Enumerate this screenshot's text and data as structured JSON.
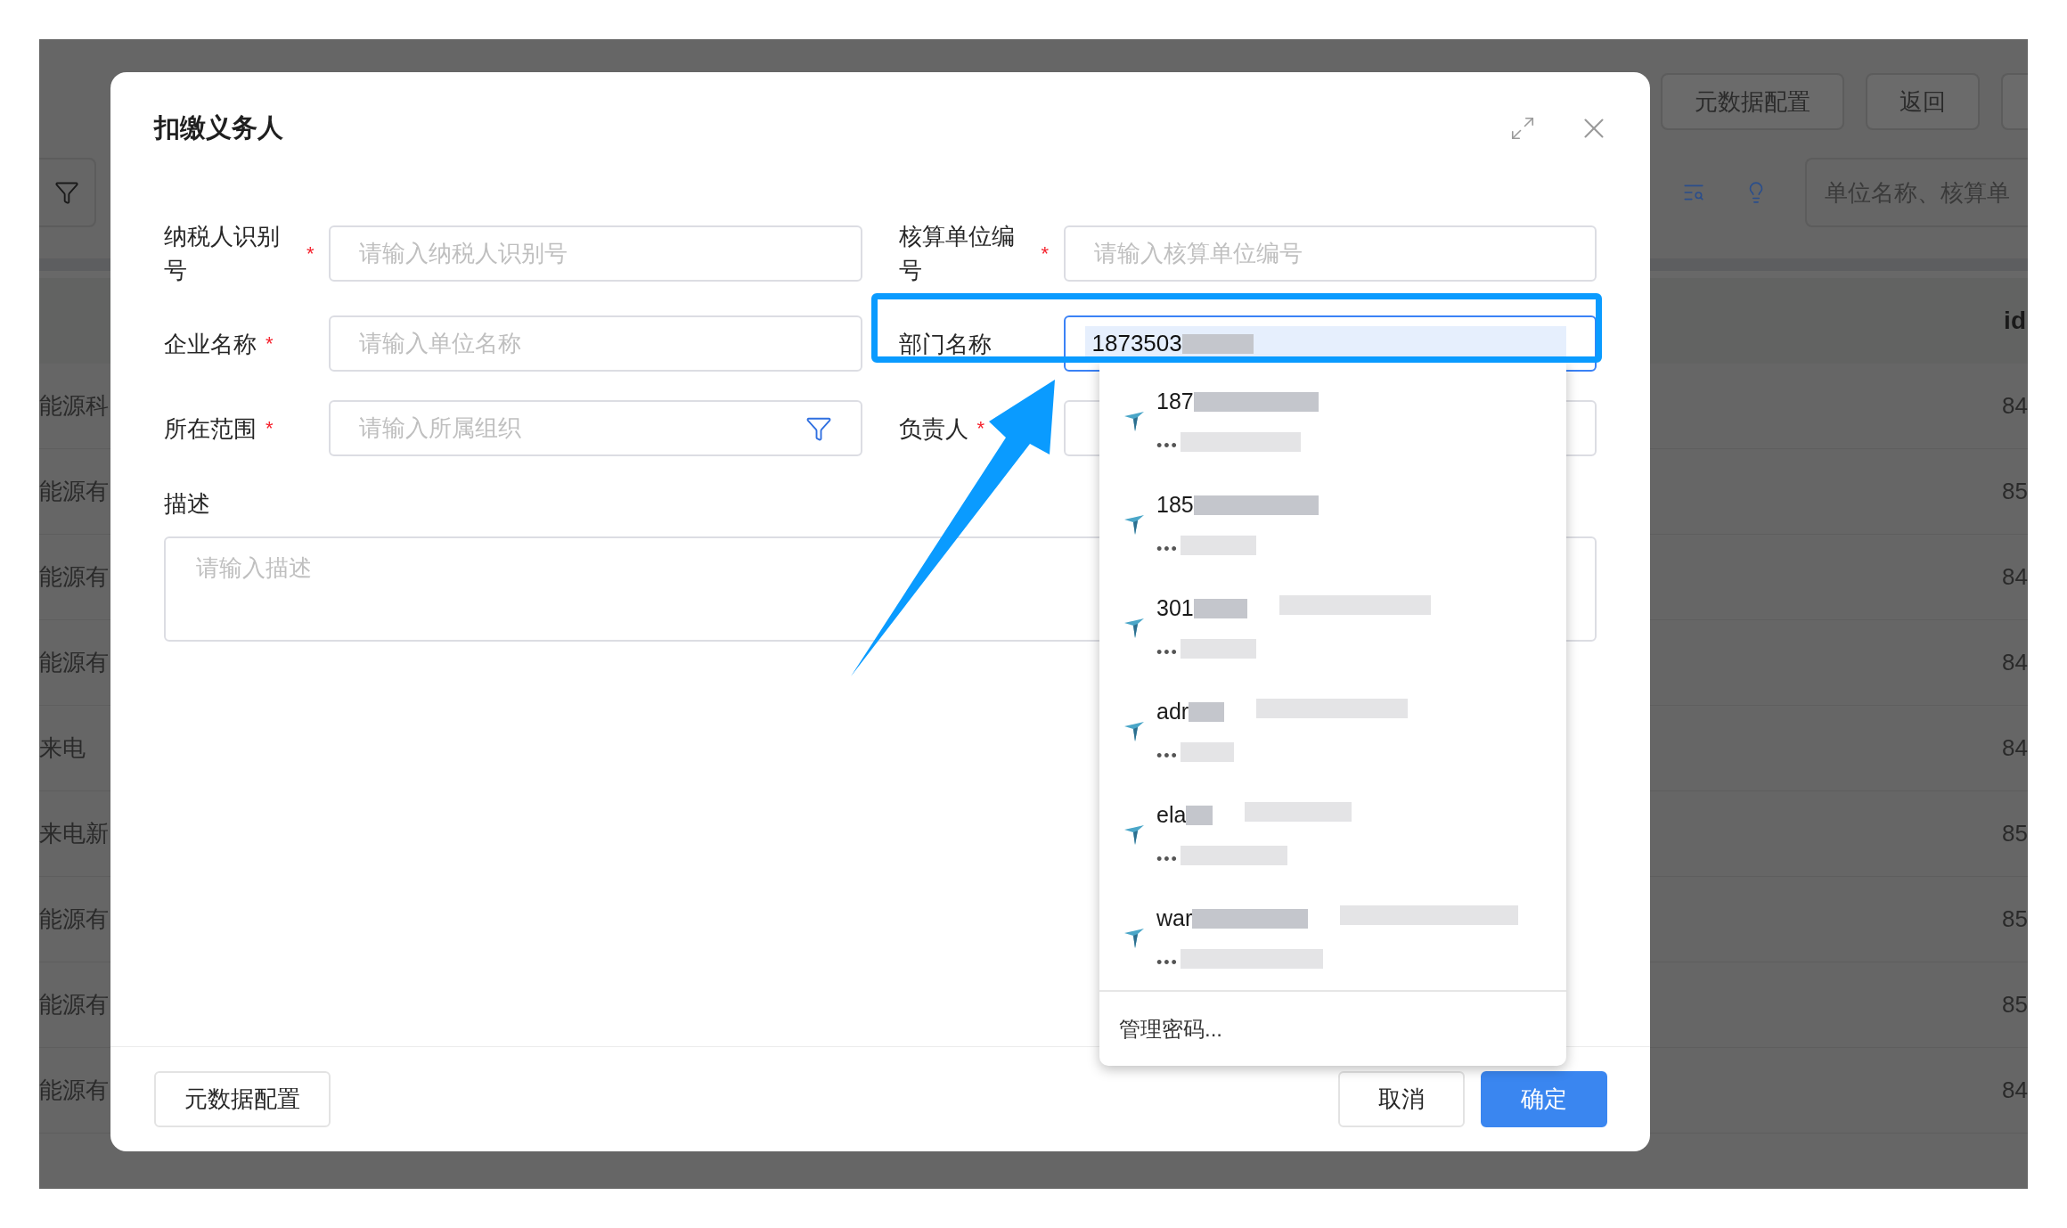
{
  "background": {
    "toolbar_buttons": [
      "元数据配置",
      "返回"
    ],
    "search": {
      "placeholder": "单位名称、核算单"
    },
    "table": {
      "columns": [
        "id"
      ],
      "rows": [
        {
          "column_1": "能源科",
          "id": "84"
        },
        {
          "column_1": "能源有",
          "id": "85"
        },
        {
          "column_1": "能源有",
          "id": "84"
        },
        {
          "column_1": "能源有",
          "id": "84"
        },
        {
          "column_1": "来电",
          "id": "84"
        },
        {
          "column_1": "来电新",
          "id": "85"
        },
        {
          "column_1": "能源有",
          "id": "85"
        },
        {
          "column_1": "能源有",
          "id": "85"
        },
        {
          "column_1": "能源有",
          "id": "84"
        }
      ]
    }
  },
  "dialog": {
    "title": "扣缴义务人",
    "fields": [
      {
        "label": "纳税人识别号",
        "required_mark": "*",
        "kind": "text",
        "placeholder": "请输入纳税人识别号"
      },
      {
        "label": "核算单位编号",
        "required_mark": "*",
        "kind": "text",
        "placeholder": "请输入核算单位编号"
      },
      {
        "label": "企业名称",
        "required_mark": "*",
        "kind": "text",
        "placeholder": "请输入单位名称"
      },
      {
        "label": "部门名称",
        "kind": "autocomplete",
        "value": "1873503"
      },
      {
        "label": "所在范围",
        "required_mark": "*",
        "kind": "filter",
        "placeholder": "请输入所属组织"
      },
      {
        "label": "负责人",
        "required_mark": "*",
        "kind": "text"
      }
    ],
    "description": {
      "label": "描述",
      "placeholder": "请输入描述"
    },
    "footer_left_button": "元数据配置",
    "buttons": [
      {
        "label": "取消",
        "kind": "default"
      },
      {
        "label": "确定",
        "kind": "primary"
      }
    ]
  },
  "autocomplete": {
    "items": [
      {
        "text": "187",
        "hint": "•••"
      },
      {
        "text": "185",
        "hint": "•••"
      },
      {
        "text": "301",
        "hint": "•••"
      },
      {
        "text": "adr",
        "hint": "•••"
      },
      {
        "text": "ela",
        "hint": "•••"
      },
      {
        "text": "war",
        "hint": "•••"
      }
    ],
    "footer": "管理密码..."
  }
}
